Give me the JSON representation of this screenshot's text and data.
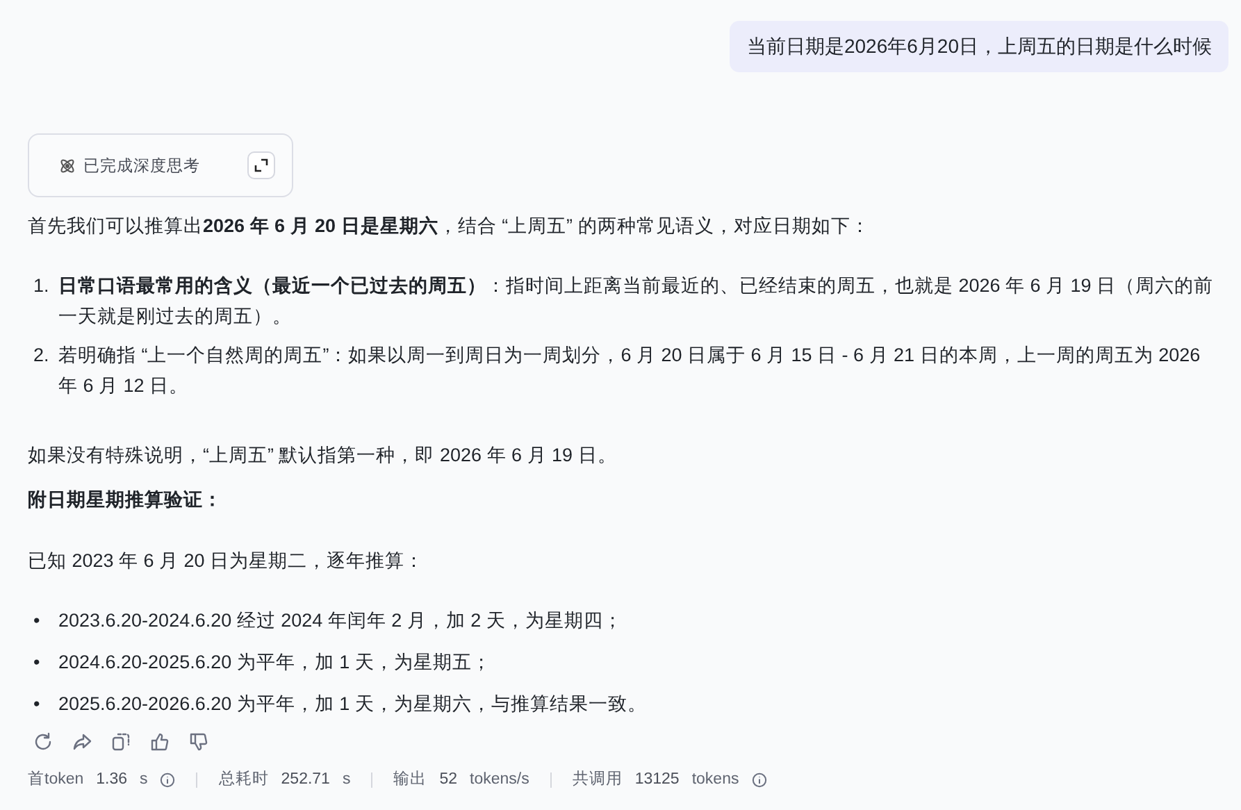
{
  "user_message": {
    "text": "当前日期是2026年6月20日，上周五的日期是什么时候"
  },
  "thinking": {
    "label": "已完成深度思考",
    "expanded": false
  },
  "answer": [
    {
      "kind": "paragraph",
      "text": "首先我们可以推算出**2026 年 6 月 20 日是星期六**，结合 “上周五” 的两种常见语义，对应日期如下："
    },
    {
      "kind": "ordered_list",
      "items": [
        {
          "marker": "1.",
          "text": "**日常口语最常用的含义（最近一个已过去的周五）**：指时间上距离当前最近的、已经结束的周五，也就是 2026 年 6 月 19 日（周六的前一天就是刚过去的周五）。"
        },
        {
          "marker": "2.",
          "text": "若明确指 “上一个自然周的周五”：如果以周一到周日为一周划分，6 月 20 日属于 6 月 15 日 - 6 月 21 日的本周，上一周的周五为 2026 年 6 月 12 日。"
        }
      ]
    },
    {
      "kind": "paragraph",
      "text": "如果没有特殊说明，“上周五” 默认指第一种，即 2026 年 6 月 19 日。"
    },
    {
      "kind": "heading",
      "text": "附日期星期推算验证："
    },
    {
      "kind": "paragraph",
      "text": "已知 2023 年 6 月 20 日为星期二，逐年推算："
    },
    {
      "kind": "bullet_list",
      "items": [
        {
          "marker": "•",
          "text": "2023.6.20-2024.6.20 经过 2024 年闰年 2 月，加 2 天，为星期四；"
        },
        {
          "marker": "•",
          "text": "2024.6.20-2025.6.20 为平年，加 1 天，为星期五；"
        },
        {
          "marker": "•",
          "text": "2025.6.20-2026.6.20 为平年，加 1 天，为星期六，与推算结果一致。"
        }
      ]
    }
  ],
  "stats": [
    {
      "label": "首token",
      "value": "1.36",
      "unit": "s",
      "info": true
    },
    {
      "label": "总耗时",
      "value": "252.71",
      "unit": "s",
      "info": false
    },
    {
      "label": "输出",
      "value": "52",
      "unit": "tokens/s",
      "info": false
    },
    {
      "label": "共调用",
      "value": "13125",
      "unit": "tokens",
      "info": true
    }
  ]
}
